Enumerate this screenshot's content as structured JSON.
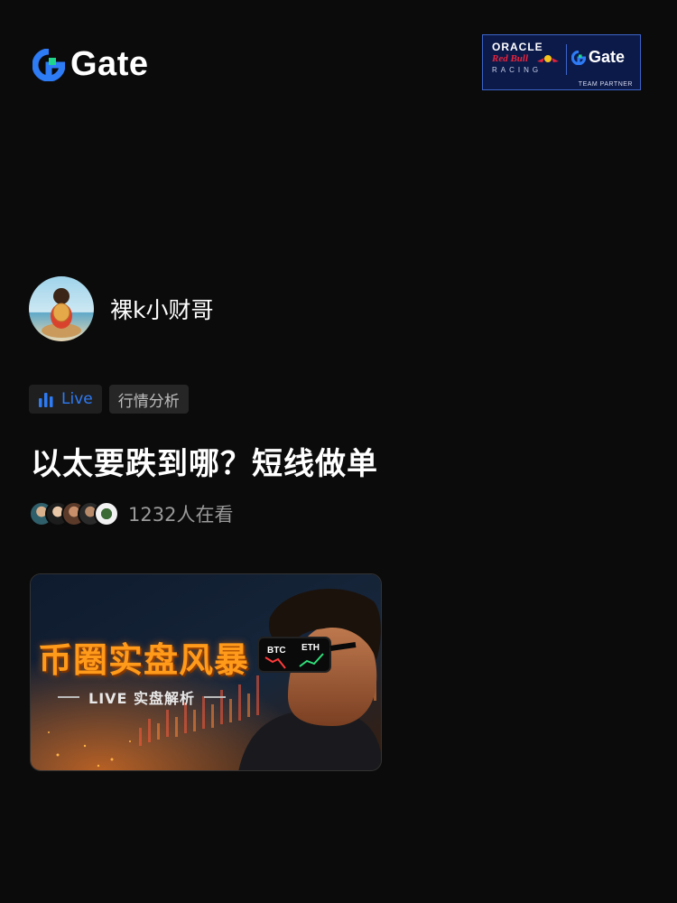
{
  "brand": {
    "logo_text": "Gate",
    "logo_icon": "gate-logo-icon",
    "accent_color": "#2e7bf6",
    "green_color": "#1fd48b"
  },
  "partner": {
    "oracle": "ORACLE",
    "red_bull": "Red Bull",
    "racing": "RACING",
    "gate": "Gate",
    "team_partner": "TEAM PARTNER"
  },
  "host": {
    "name": "裸k小财哥",
    "avatar_icon": "host-avatar"
  },
  "tags": {
    "live_label": "Live",
    "live_icon": "bar-chart-icon",
    "topic_label": "行情分析"
  },
  "stream": {
    "title": "以太要跌到哪？短线做单",
    "viewer_count": "1232人在看"
  },
  "cover": {
    "title": "币圈实盘风暴",
    "subtitle": "LIVE 实盘解析",
    "lens_left": "BTC",
    "lens_right": "ETH"
  }
}
